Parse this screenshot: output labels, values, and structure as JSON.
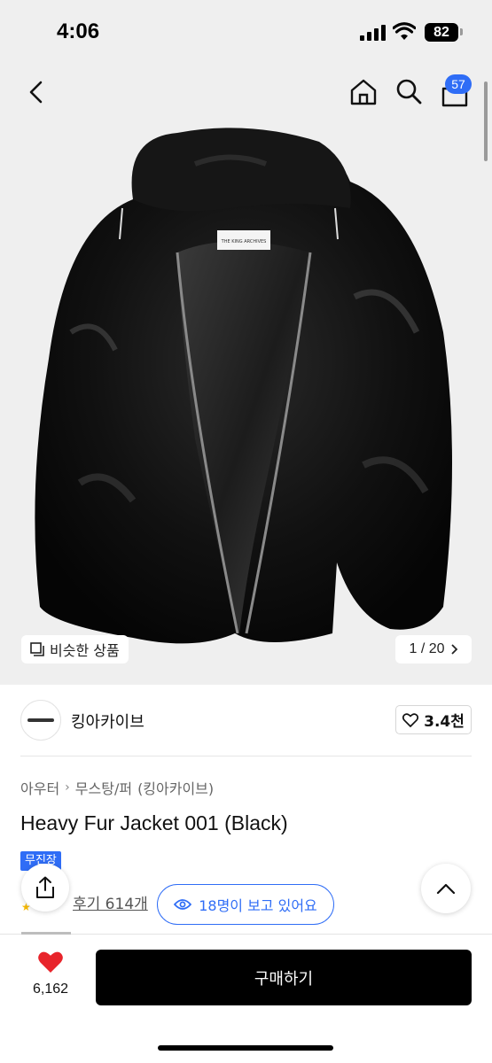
{
  "status_bar": {
    "time": "4:06",
    "battery": "82"
  },
  "nav": {
    "cart_count": "57"
  },
  "hero": {
    "similar_label": "비슷한 상품",
    "pager": "1 / 20",
    "label_text": "THE KING ARCHIVES"
  },
  "brand": {
    "name": "킹아카이브",
    "likes": "3.4천"
  },
  "breadcrumb": [
    "아우터",
    "무스탕/퍼",
    "(킹아카이브)"
  ],
  "product": {
    "title": "Heavy Fur Jacket 001 (Black)",
    "badge": "무진장",
    "reviews": "후기 614개",
    "viewers": "18명이 보고 있어요"
  },
  "bottom": {
    "heart_count": "6,162",
    "buy_label": "구매하기"
  },
  "colors": {
    "accent": "#2f6df6",
    "heart": "#e8242b"
  }
}
